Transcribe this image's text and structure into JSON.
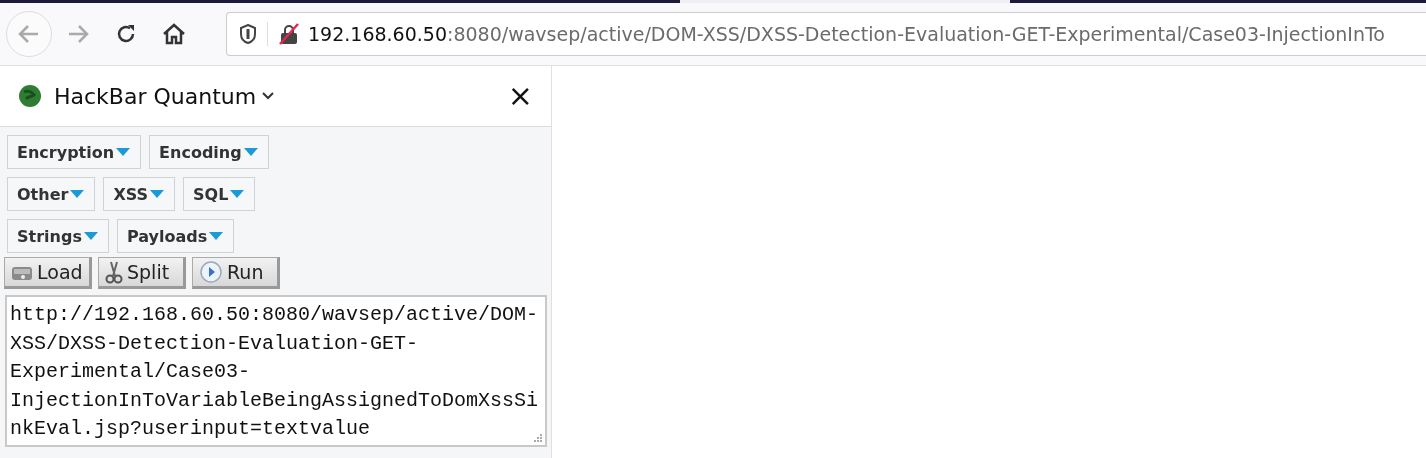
{
  "browser": {
    "address_host": "192.168.60.50",
    "address_rest": ":8080/wavsep/active/DOM-XSS/DXSS-Detection-Evaluation-GET-Experimental/Case03-InjectionInTo"
  },
  "sidebar": {
    "title": "HackBar Quantum",
    "close": "×",
    "menu_rows": [
      [
        "Encryption",
        "Encoding"
      ],
      [
        "Other",
        "XSS",
        "SQL"
      ],
      [
        "Strings",
        "Payloads"
      ]
    ],
    "actions": [
      {
        "kind": "load",
        "label": "Load"
      },
      {
        "kind": "split",
        "label": "Split"
      },
      {
        "kind": "run",
        "label": "Run"
      }
    ],
    "url_value": "http://192.168.60.50:8080/wavsep/active/DOM-XSS/DXSS-Detection-Evaluation-GET-Experimental/Case03-InjectionInToVariableBeingAssignedToDomXssSinkEval.jsp?userinput=textvalue"
  }
}
